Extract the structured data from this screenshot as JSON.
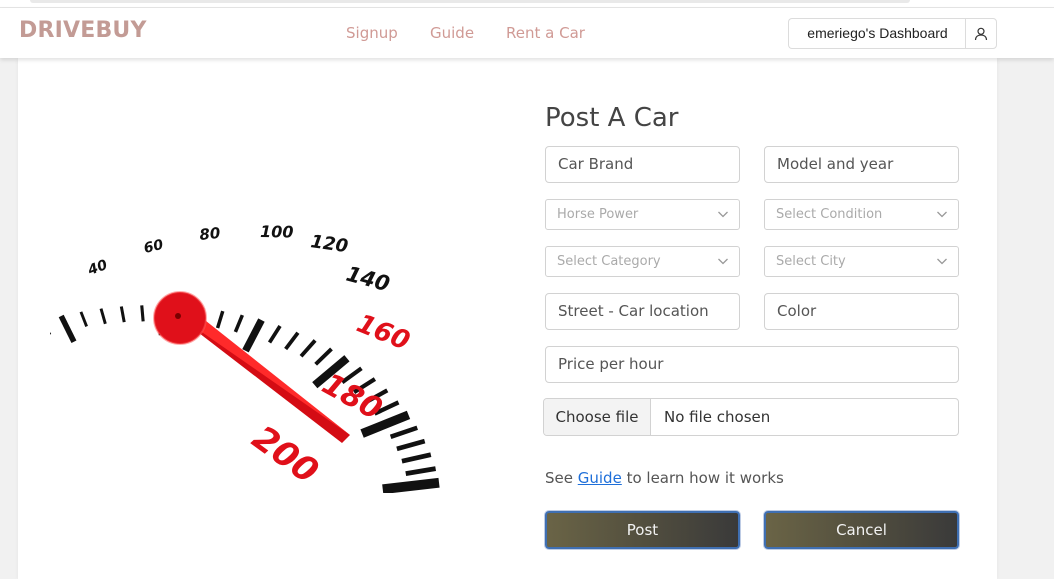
{
  "navbar": {
    "brand": "DRIVEBUY",
    "links": [
      "Signup",
      "Guide",
      "Rent a Car"
    ],
    "dashboard_label": "emeriego's Dashboard",
    "user_icon": "user-icon"
  },
  "hero": {
    "image": "speedometer-graphic",
    "gauge_labels": [
      "40",
      "60",
      "80",
      "100",
      "120",
      "140",
      "160",
      "180",
      "200"
    ]
  },
  "form": {
    "title": "Post A Car",
    "car_brand_placeholder": "Car Brand",
    "model_year_placeholder": "Model and year",
    "horse_power_select": "Horse Power",
    "condition_select": "Select Condition",
    "category_select": "Select Category",
    "city_select": "Select City",
    "street_placeholder": "Street - Car location",
    "color_placeholder": "Color",
    "price_placeholder": "Price per hour",
    "file_button": "Choose file",
    "file_status": "No file chosen",
    "guide_prefix": "See ",
    "guide_link": "Guide",
    "guide_suffix": " to learn how it works",
    "post_button": "Post",
    "cancel_button": "Cancel"
  },
  "colors": {
    "brand": "#c39b95",
    "nav_link": "#d09a95",
    "link_blue": "#1e6fd9",
    "button_border": "#3f6fb2",
    "needle_red": "#e0101a"
  }
}
